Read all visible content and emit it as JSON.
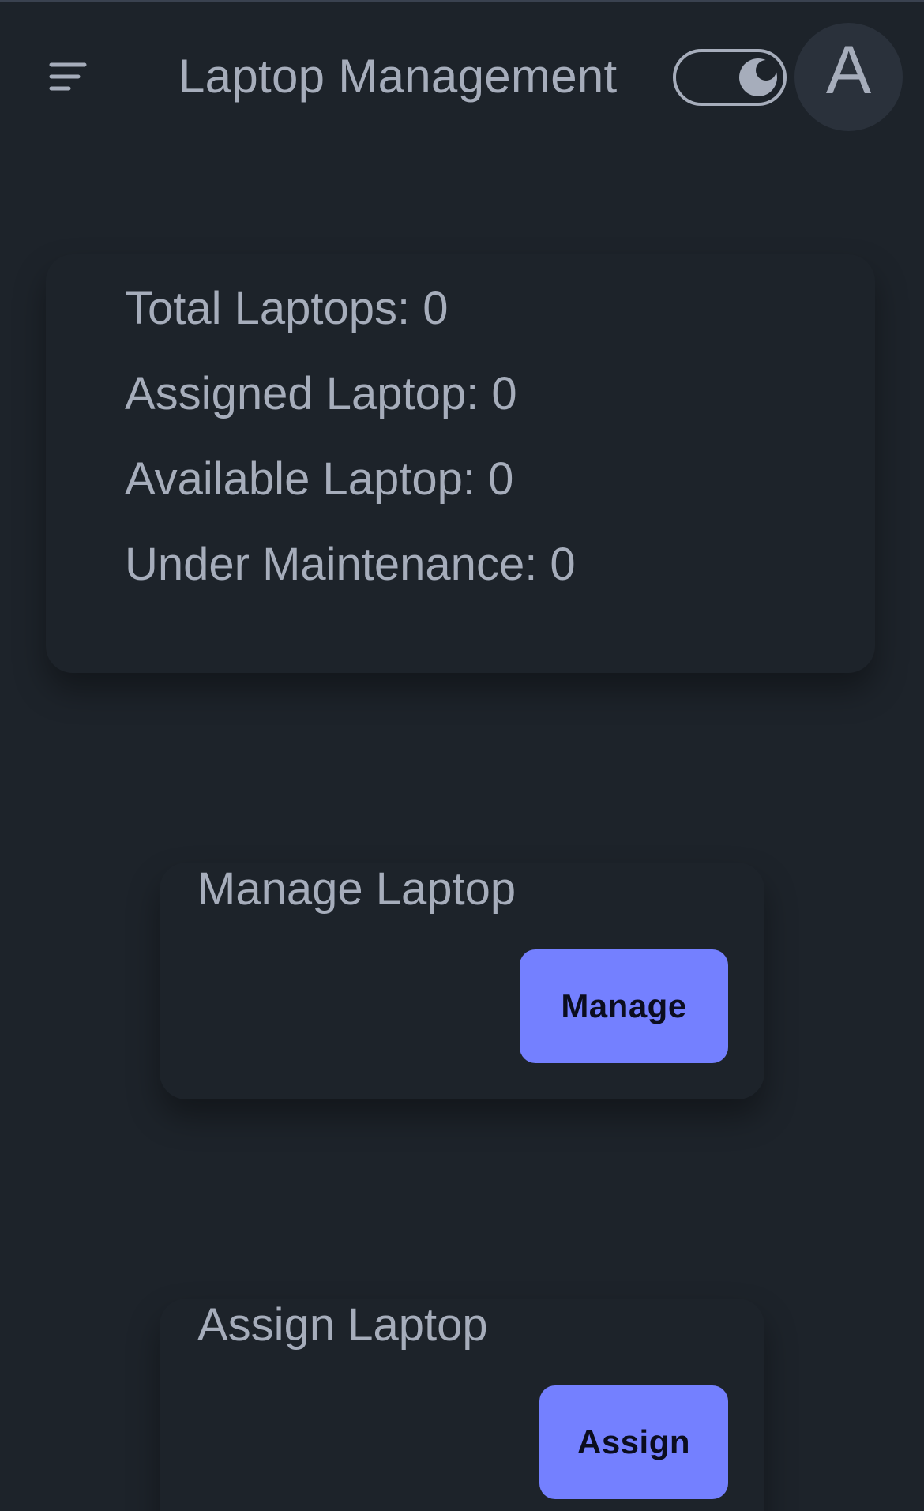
{
  "header": {
    "title": "Laptop Management",
    "menu_icon": "hamburger-menu-icon",
    "theme_icon": "moon-icon",
    "avatar_initial": "A"
  },
  "stats": [
    {
      "label": "Total Laptops: 0"
    },
    {
      "label": "Assigned Laptop: 0"
    },
    {
      "label": "Available Laptop: 0"
    },
    {
      "label": "Under Maintenance: 0"
    }
  ],
  "manage_card": {
    "title": "Manage Laptop",
    "button_label": "Manage"
  },
  "assign_card": {
    "title": "Assign Laptop",
    "button_label": "Assign"
  },
  "colors": {
    "background": "#1d232a",
    "text": "#a6adbb",
    "primary": "#7480ff",
    "primary_text": "#0b0d1f",
    "avatar_bg": "#2a313b"
  }
}
